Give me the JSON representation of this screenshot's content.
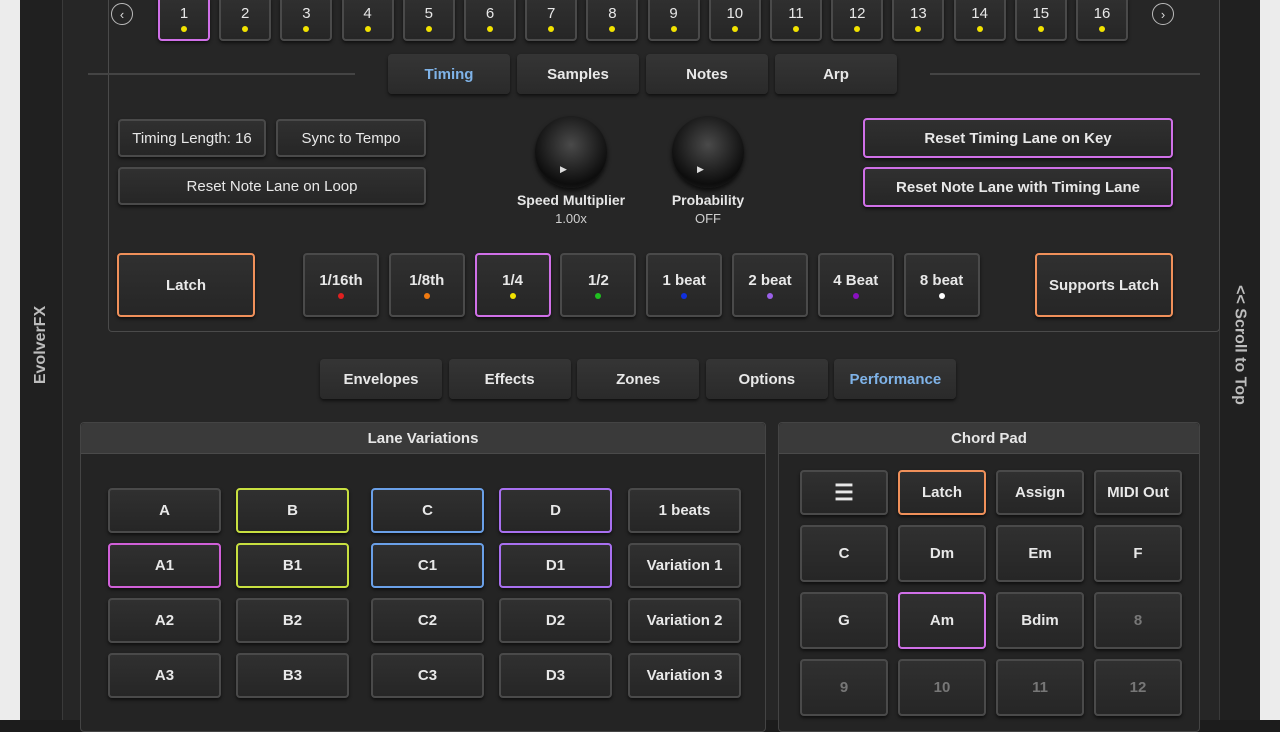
{
  "app": {
    "side_title": "EvolverFX",
    "scroll_label": "<< Scroll to Top"
  },
  "steps": {
    "prev_icon": "chevron-left-icon",
    "next_icon": "chevron-right-icon",
    "items": [
      "1",
      "2",
      "3",
      "4",
      "5",
      "6",
      "7",
      "8",
      "9",
      "10",
      "11",
      "12",
      "13",
      "14",
      "15",
      "16"
    ],
    "selected": "1"
  },
  "lane_tabs": [
    "Timing",
    "Samples",
    "Notes",
    "Arp"
  ],
  "lane_tab_active": "Timing",
  "timing": {
    "length_label": "Timing Length: 16",
    "sync_label": "Sync to Tempo",
    "reset_note_loop_label": "Reset Note Lane on Loop",
    "speed": {
      "label": "Speed Multiplier",
      "value": "1.00x"
    },
    "probability": {
      "label": "Probability",
      "value": "OFF"
    },
    "reset_timing_key_label": "Reset Timing Lane on Key",
    "reset_note_timing_label": "Reset Note Lane with Timing Lane",
    "latch_label": "Latch",
    "supports_latch_label": "Supports Latch",
    "divisions": [
      {
        "label": "1/16th",
        "color": "#e02020"
      },
      {
        "label": "1/8th",
        "color": "#f07a10"
      },
      {
        "label": "1/4",
        "color": "#f2e300"
      },
      {
        "label": "1/2",
        "color": "#20c020"
      },
      {
        "label": "1 beat",
        "color": "#1030e0"
      },
      {
        "label": "2 beat",
        "color": "#9a60e8"
      },
      {
        "label": "4 Beat",
        "color": "#8a10c0"
      },
      {
        "label": "8 beat",
        "color": "#ffffff"
      }
    ],
    "selected_division": "1/4"
  },
  "main_tabs": [
    "Envelopes",
    "Effects",
    "Zones",
    "Options",
    "Performance"
  ],
  "main_tab_active": "Performance",
  "lane_variations": {
    "title": "Lane Variations",
    "rows": [
      [
        "A",
        "B",
        "C",
        "D",
        "1 beats"
      ],
      [
        "A1",
        "B1",
        "C1",
        "D1",
        "Variation 1"
      ],
      [
        "A2",
        "B2",
        "C2",
        "D2",
        "Variation 2"
      ],
      [
        "A3",
        "B3",
        "C3",
        "D3",
        "Variation 3"
      ]
    ]
  },
  "chord_pad": {
    "title": "Chord Pad",
    "menu_icon": "hamburger-menu-icon",
    "top": [
      "Latch",
      "Assign",
      "MIDI Out"
    ],
    "chords": [
      "C",
      "Dm",
      "Em",
      "F",
      "G",
      "Am",
      "Bdim",
      "8",
      "9",
      "10",
      "11",
      "12"
    ]
  }
}
